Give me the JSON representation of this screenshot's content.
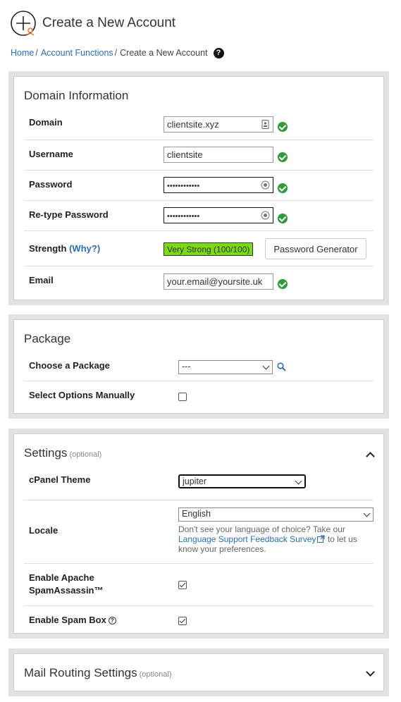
{
  "header": {
    "title": "Create a New Account",
    "icon": "add-account-icon"
  },
  "breadcrumb": {
    "home": "Home",
    "account_functions": "Account Functions",
    "current": "Create a New Account",
    "separator": "/",
    "help_icon": "?"
  },
  "domain_info": {
    "title": "Domain Information",
    "domain": {
      "label": "Domain",
      "value": "clientsite.xyz"
    },
    "username": {
      "label": "Username",
      "value": "clientsite"
    },
    "password": {
      "label": "Password",
      "value": "••••••••••••"
    },
    "retype": {
      "label": "Re-type Password",
      "value": "••••••••••••"
    },
    "strength": {
      "label": "Strength",
      "why_open": "(",
      "why": "Why?",
      "why_close": ")",
      "value": "Very Strong (100/100)",
      "color": "#7bdb12"
    },
    "password_generator": "Password Generator",
    "email": {
      "label": "Email",
      "value": "your.email@yoursite.uk"
    },
    "valid_color": "#2e9a3a"
  },
  "package": {
    "title": "Package",
    "choose": {
      "label": "Choose a Package",
      "value": "---"
    },
    "manual": {
      "label": "Select Options Manually",
      "checked": false
    }
  },
  "settings": {
    "title": "Settings",
    "optional": "(optional)",
    "theme": {
      "label": "cPanel Theme",
      "value": "jupiter"
    },
    "locale": {
      "label": "Locale",
      "value": "English",
      "note_pre": "Don't see your language of choice? Take our",
      "note_link": "Language Support Feedback Survey",
      "note_post": "to let us know your preferences."
    },
    "spamassassin": {
      "label_line1": "Enable Apache",
      "label_line2": "SpamAssassin™",
      "checked": true
    },
    "spambox": {
      "label": "Enable Spam Box",
      "checked": true
    }
  },
  "mail_routing": {
    "title": "Mail Routing Settings",
    "optional": "(optional)"
  },
  "colors": {
    "link": "#2a6ebb",
    "panel_bg": "#e2e2e2"
  }
}
